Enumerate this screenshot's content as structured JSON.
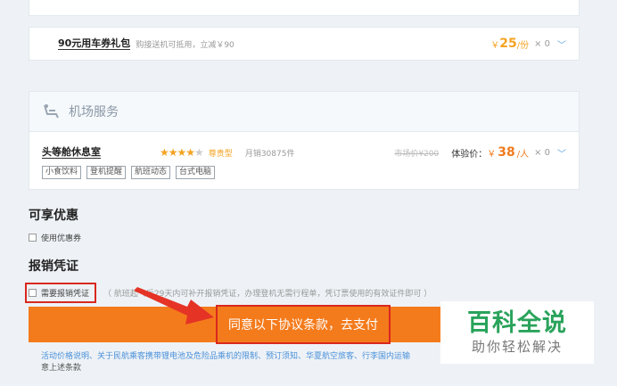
{
  "coupon": {
    "name": "90元用车券礼包",
    "desc": "购接送机可抵用，立减￥90",
    "price_prefix": "￥",
    "price": "25",
    "price_unit": "/份",
    "qty": "× 0"
  },
  "airport_service": {
    "title": "机场服务",
    "lounge": {
      "name": "头等舱休息室",
      "stars_on": "★★★★",
      "stars_off": "★",
      "type": "尊贵型",
      "sales": "月销30875件",
      "market_price": "市场价¥200",
      "exp_label": "体验价：",
      "exp_prefix": "￥",
      "exp_price": "38",
      "exp_unit": "/人",
      "qty": "× 0",
      "tags": [
        "小食饮料",
        "登机提醒",
        "航班动态",
        "台式电脑"
      ]
    }
  },
  "discount": {
    "title": "可享优惠",
    "use_coupon_label": "使用优惠券"
  },
  "receipt": {
    "title": "报销凭证",
    "need_receipt_label": "需要报销凭证",
    "note": "（ 航班起飞后29天内可补开报销凭证，办理登机无需行程单，凭订票使用的有效证件即可 ）"
  },
  "pay": {
    "button_label": "同意以下协议条款，去支付"
  },
  "footer": {
    "links": "活动价格说明、关于民航乘客携带锂电池及危险品乘机的限制、预订须知、华夏航空旅客、行李国内运输",
    "tail": "意上述条款"
  },
  "watermark": {
    "main": "百科全说",
    "sub": "助你轻松解决"
  },
  "colors": {
    "orange": "#f47b1c",
    "red_highlight": "#d9281e",
    "link_blue": "#4a90d9",
    "watermark_green": "#29a35b"
  }
}
